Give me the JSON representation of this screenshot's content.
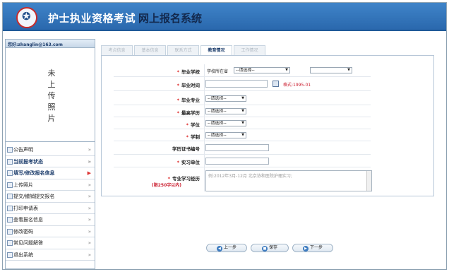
{
  "header": {
    "title_main": "护士执业资格考试",
    "title_sub": "网上报名系统"
  },
  "sidebar": {
    "welcome": "您好:zhanglin@163.com",
    "photo_placeholder": [
      "未",
      "上",
      "传",
      "照",
      "片"
    ],
    "items": [
      {
        "label": "公告声明",
        "bold": false,
        "icon": "house-icon"
      },
      {
        "label": "当前报考状态",
        "bold": true,
        "icon": "document-icon"
      },
      {
        "label": "填写/修改报名信息",
        "bold": true,
        "icon": "document-icon",
        "active_arrow": true
      },
      {
        "label": "上传照片",
        "bold": false,
        "icon": "document-icon"
      },
      {
        "label": "提交/撤销提交报名",
        "bold": false,
        "icon": "document-icon"
      },
      {
        "label": "打印申请表",
        "bold": false,
        "icon": "document-icon"
      },
      {
        "label": "查看报名信息",
        "bold": false,
        "icon": "document-icon"
      },
      {
        "label": "修改密码",
        "bold": false,
        "icon": "document-icon"
      },
      {
        "label": "常见问题解答",
        "bold": false,
        "icon": "document-icon"
      },
      {
        "label": "退出系统",
        "bold": false,
        "icon": "document-icon"
      }
    ]
  },
  "tabs": [
    "考点信息",
    "基本信息",
    "联系方式",
    "教育情况",
    "工作情况"
  ],
  "active_tab": 3,
  "form": {
    "school": {
      "label": "毕业学校",
      "province_label": "学校所在省",
      "province_value": "--请选择--",
      "school_value": ""
    },
    "grad_time": {
      "label": "毕业时间",
      "hint": "格式:1995-01"
    },
    "major": {
      "label": "毕业专业",
      "value": "--请选择--"
    },
    "education": {
      "label": "最高学历",
      "value": "--请选择--"
    },
    "degree": {
      "label": "学位",
      "value": "--请选择--"
    },
    "duration": {
      "label": "学制",
      "value": "--请选择--"
    },
    "cert_no": {
      "label": "学历证书编号"
    },
    "intern": {
      "label": "实习单位"
    },
    "study": {
      "label": "专业学习经历",
      "note": "(限250字以内)",
      "placeholder": "例:2012年3月-12月  北京协和医院护理实习;"
    }
  },
  "buttons": {
    "prev": "上一步",
    "save": "保存",
    "next": "下一步"
  },
  "colors": {
    "header": "#2a68ad",
    "required": "#d22222",
    "hint": "#cc2233"
  }
}
